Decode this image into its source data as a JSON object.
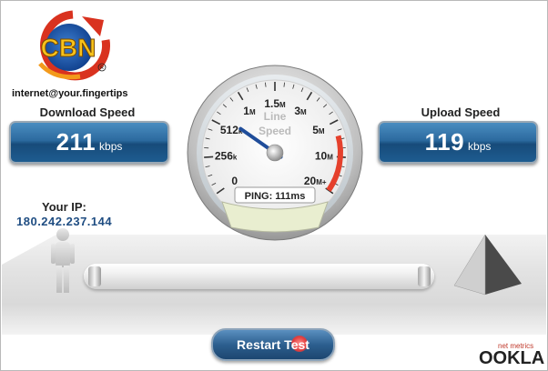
{
  "brand": {
    "logo_text": "CBN",
    "tagline": "internet@your.fingertips"
  },
  "download": {
    "label": "Download Speed",
    "value": "211",
    "unit": "kbps"
  },
  "upload": {
    "label": "Upload Speed",
    "value": "119",
    "unit": "kbps"
  },
  "ip": {
    "label": "Your IP:",
    "value": "180.242.237.144"
  },
  "gauge": {
    "title_line1": "Line",
    "title_line2": "Speed",
    "ticks": [
      {
        "main": "0",
        "suffix": ""
      },
      {
        "main": "256",
        "suffix": "k"
      },
      {
        "main": "512",
        "suffix": "k"
      },
      {
        "main": "1",
        "suffix": "M"
      },
      {
        "main": "1.5",
        "suffix": "M"
      },
      {
        "main": "3",
        "suffix": "M"
      },
      {
        "main": "5",
        "suffix": "M"
      },
      {
        "main": "10",
        "suffix": "M"
      },
      {
        "main": "20",
        "suffix": "M+"
      }
    ],
    "needle_position_fraction": 0.28,
    "ping_text": "PING: 111ms"
  },
  "actions": {
    "restart_label": "Restart Test"
  },
  "footer": {
    "vendor_name": "OOKLA",
    "vendor_sub": "net metrics"
  },
  "colors": {
    "panel_blue": "#2c6a9f",
    "ip_blue": "#1f4d82",
    "redline": "#e5402c",
    "needle": "#1f4d9a"
  }
}
